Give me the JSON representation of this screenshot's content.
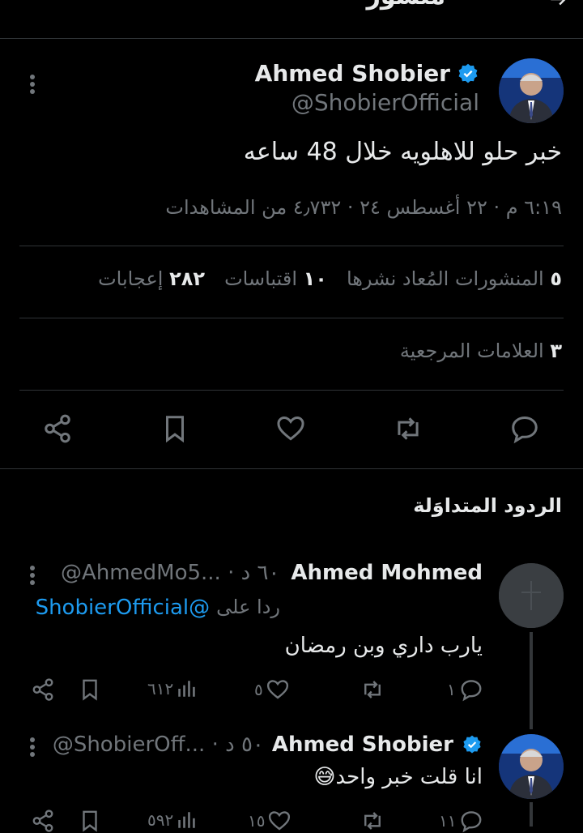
{
  "header": {
    "title": "منشور"
  },
  "tweet": {
    "author_name": "Ahmed Shobier",
    "author_handle": "@ShobierOfficial",
    "text": "خبر حلو للاهلويه خلال 48 ساعه",
    "meta": "٦:١٩ م · ٢٢ أغسطس ٢٤ · ٤٫٧٣٢ من المشاهدات",
    "stats": {
      "reposts_count": "٥",
      "reposts_label": "المنشورات المُعاد نشرها",
      "quotes_count": "١٠",
      "quotes_label": "اقتباسات",
      "likes_count": "٢٨٢",
      "likes_label": "إعجابات",
      "bookmarks_count": "٣",
      "bookmarks_label": "العلامات المرجعية"
    }
  },
  "replies_section": {
    "title": "الردود المتداوَلة"
  },
  "replies": [
    {
      "author_name": "Ahmed Mohmed",
      "handle_time": "@AhmedMo5... · ٦٠ د",
      "reply_to_prefix": "ردا على",
      "reply_to_handle": "@ShobierOfficial",
      "text": "يارب داري وبن رمضان",
      "views": "٦١٢",
      "likes": "٥",
      "replies": "١"
    },
    {
      "author_name": "Ahmed Shobier",
      "handle_time": "@ShobierOff... · ٥٠ د",
      "text": "انا قلت خبر واحد😅",
      "views": "٥٩٢",
      "likes": "١٥",
      "replies": "١١"
    }
  ],
  "colors": {
    "accent": "#1d9bf0",
    "secondary_text": "#71767b",
    "divider": "#2f3336"
  }
}
